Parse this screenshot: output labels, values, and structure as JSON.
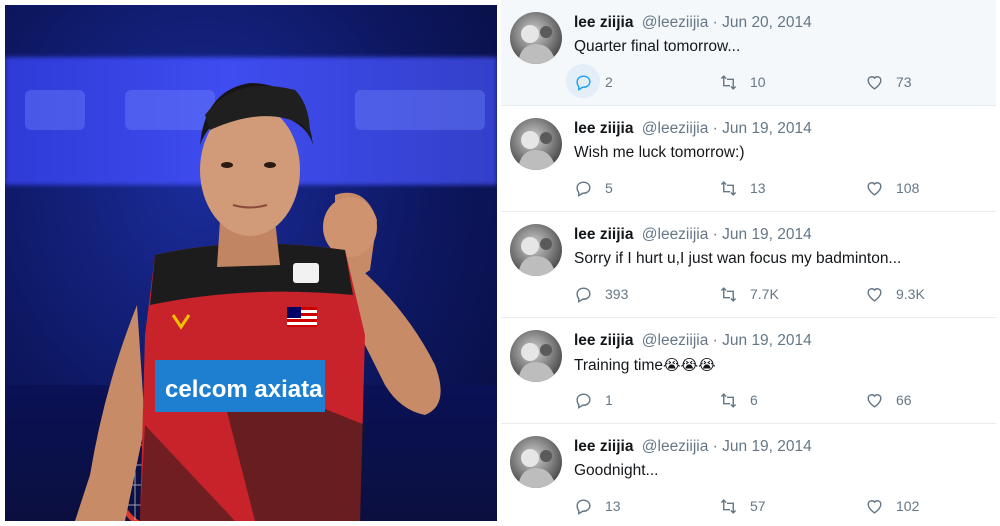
{
  "photo": {
    "jersey_text": "celcom axiata",
    "caption_icon": "badminton-player-photo"
  },
  "tweets": [
    {
      "name": "lee ziijia",
      "handle": "@leeziijia",
      "date": "Jun 20, 2014",
      "text": "Quarter final tomorrow...",
      "replies": "2",
      "retweets": "10",
      "likes": "73"
    },
    {
      "name": "lee ziijia",
      "handle": "@leeziijia",
      "date": "Jun 19, 2014",
      "text": "Wish me luck tomorrow:)",
      "replies": "5",
      "retweets": "13",
      "likes": "108"
    },
    {
      "name": "lee ziijia",
      "handle": "@leeziijia",
      "date": "Jun 19, 2014",
      "text": "Sorry if I hurt u,I just wan focus my badminton...",
      "replies": "393",
      "retweets": "7.7K",
      "likes": "9.3K"
    },
    {
      "name": "lee ziijia",
      "handle": "@leeziijia",
      "date": "Jun 19, 2014",
      "text": "Training time",
      "emoji": "😭😭😭",
      "replies": "1",
      "retweets": "6",
      "likes": "66"
    },
    {
      "name": "lee ziijia",
      "handle": "@leeziijia",
      "date": "Jun 19, 2014",
      "text": "Goodnight...",
      "replies": "13",
      "retweets": "57",
      "likes": "102"
    }
  ],
  "separator": "·",
  "colors": {
    "muted": "#657786",
    "text": "#14171a",
    "highlight": "#f5f8fa",
    "accent": "#1da1f2"
  }
}
